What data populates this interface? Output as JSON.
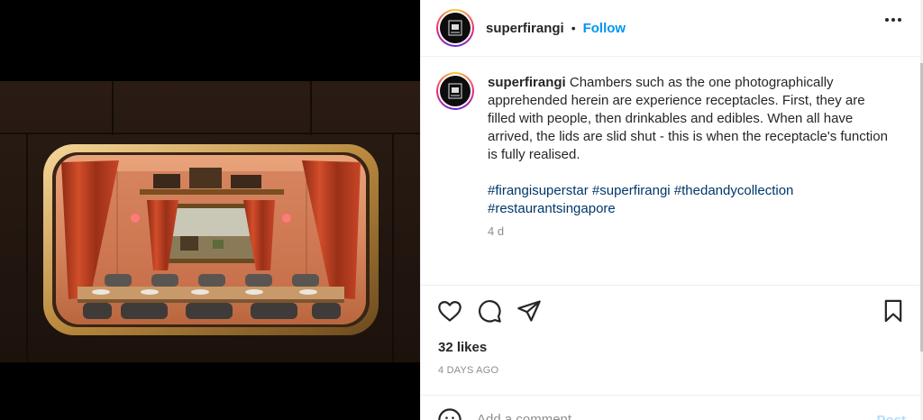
{
  "post": {
    "username": "superfirangi",
    "follow_label": "Follow",
    "dot": "•",
    "caption": "Chambers such as the one photographically apprehended herein are experience receptacles. First, they are filled with people, then drinkables and edibles. When all have arrived, the lids are slid shut - this is when the receptacle's function is fully realised.",
    "hashtags": [
      "#firangisuperstar",
      "#superfirangi",
      "#thedandycollection",
      "#restaurantsingapore"
    ],
    "caption_age": "4 d",
    "likes": "32 likes",
    "posted_ago": "4 DAYS AGO"
  },
  "comment": {
    "placeholder": "Add a comment…",
    "post_label": "Post"
  },
  "icons": {
    "more": "more-options-icon",
    "like": "heart-icon",
    "comment": "comment-icon",
    "share": "send-icon",
    "save": "bookmark-icon",
    "emoji": "emoji-icon"
  },
  "colors": {
    "follow": "#0095f6",
    "hashtag": "#00376b",
    "muted": "#8e8e8e"
  }
}
